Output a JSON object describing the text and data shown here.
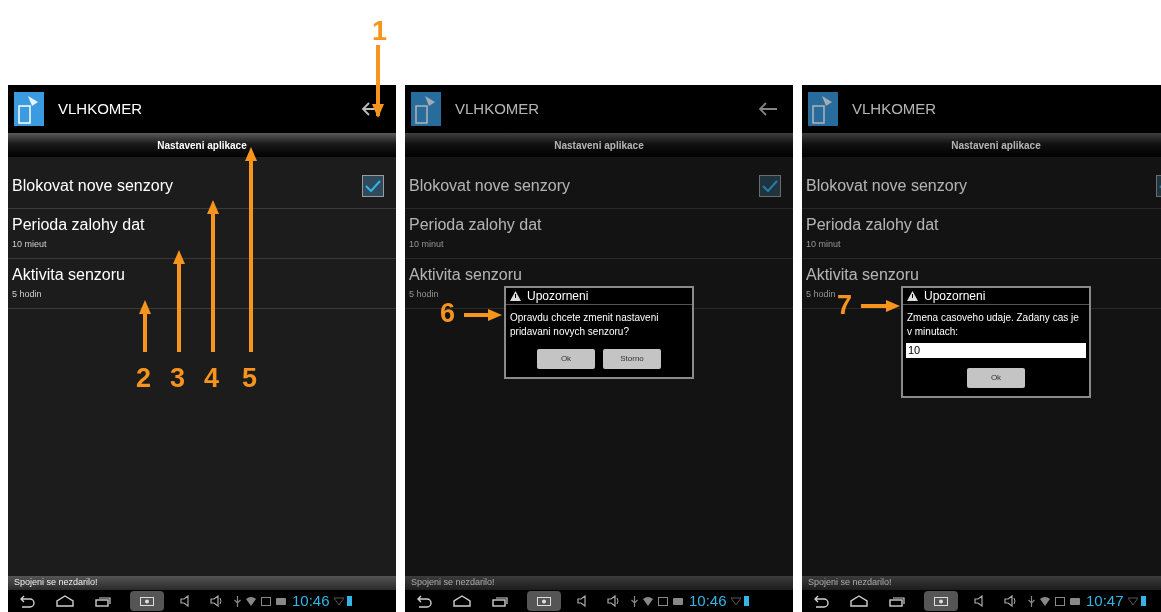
{
  "screens": [
    {
      "app_title": "VLHKOMER",
      "show_back": true,
      "header": "Nastaveni aplikace",
      "settings": [
        {
          "kind": "checkbox",
          "title": "Blokovat nove senzory",
          "checked": true
        },
        {
          "kind": "value",
          "title": "Perioda zalohy dat",
          "subtitle": "10 mieut"
        },
        {
          "kind": "value",
          "title": "Aktivita senzoru",
          "subtitle": "5 hodin"
        }
      ],
      "status_message": "Spojeni se nezdarilo!",
      "clock": "10:46"
    },
    {
      "app_title": "VLHKOMER",
      "show_back": true,
      "header": "Nastaveni aplikace",
      "settings": [
        {
          "kind": "checkbox",
          "title": "Blokovat nove senzory",
          "checked": true
        },
        {
          "kind": "value",
          "title": "Perioda zalohy dat",
          "subtitle": "10 minut"
        },
        {
          "kind": "value",
          "title": "Aktivita senzoru",
          "subtitle": "5 hodin"
        }
      ],
      "status_message": "Spojeni se nezdarilo!",
      "clock": "10:46",
      "dialog": {
        "title": "Upozorneni",
        "message": "Opravdu chcete zmenit nastaveni pridavani novych senzoru?",
        "buttons": [
          "Ok",
          "Storno"
        ]
      }
    },
    {
      "app_title": "VLHKOMER",
      "show_back": false,
      "header": "Nastaveni aplikace",
      "settings": [
        {
          "kind": "checkbox",
          "title": "Blokovat nove senzory",
          "checked": true
        },
        {
          "kind": "value",
          "title": "Perioda zalohy dat",
          "subtitle": "10 minut"
        },
        {
          "kind": "value",
          "title": "Aktivita senzoru",
          "subtitle": "5 hodin"
        }
      ],
      "status_message": "Spojeni se nezdarilo!",
      "clock": "10:47",
      "dialog": {
        "title": "Upozorneni",
        "message": "Zmena casoveho udaje. Zadany cas je v minutach:",
        "input_value": "10",
        "buttons": [
          "Ok"
        ]
      }
    }
  ],
  "annotations": [
    "1",
    "2",
    "3",
    "4",
    "5",
    "6",
    "7"
  ]
}
